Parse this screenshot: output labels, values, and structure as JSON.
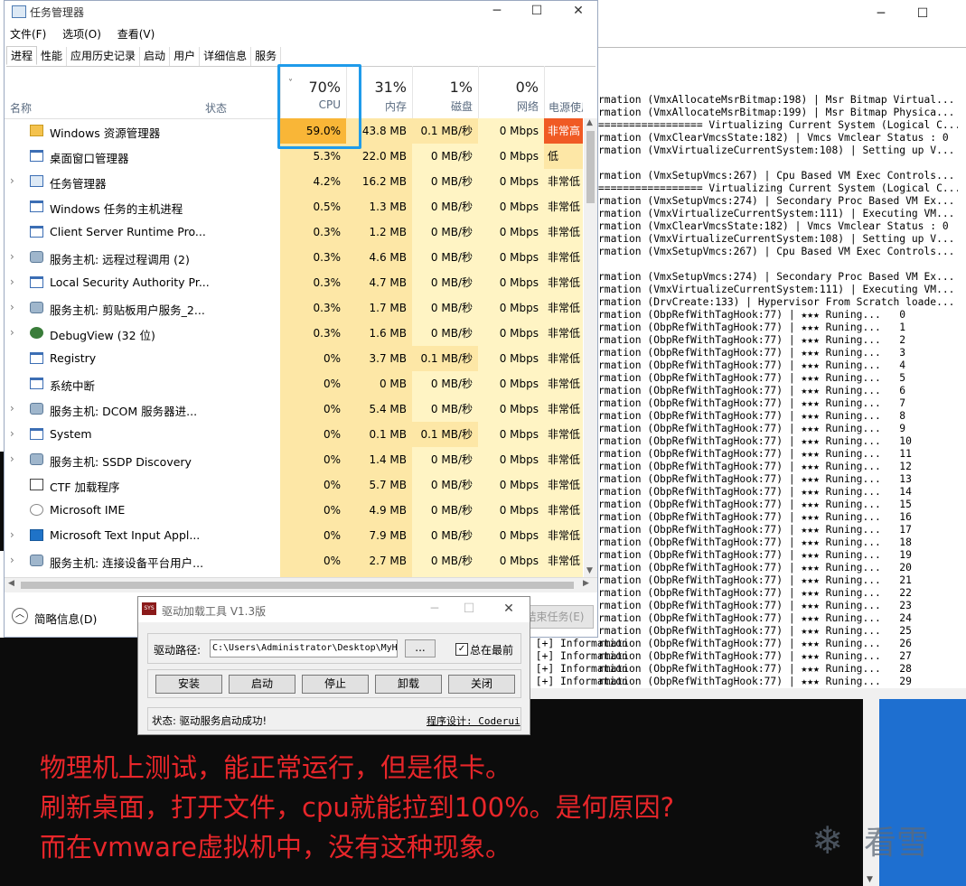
{
  "taskmgr": {
    "title": "任务管理器",
    "menu": [
      "文件(F)",
      "选项(O)",
      "查看(V)"
    ],
    "tabs": [
      "进程",
      "性能",
      "应用历史记录",
      "启动",
      "用户",
      "详细信息",
      "服务"
    ],
    "columns": {
      "name": "名称",
      "status": "状态",
      "cpu": {
        "pct": "70%",
        "label": "CPU"
      },
      "mem": {
        "pct": "31%",
        "label": "内存"
      },
      "disk": {
        "pct": "1%",
        "label": "磁盘"
      },
      "net": {
        "pct": "0%",
        "label": "网络"
      },
      "power": "电源使用"
    },
    "processes": [
      {
        "name": "Windows 资源管理器",
        "expand": false,
        "cpu": "59.0%",
        "mem": "43.8 MB",
        "disk": "0.1 MB/秒",
        "net": "0 Mbps",
        "power": "非常高",
        "icon": "explorer-icon"
      },
      {
        "name": "桌面窗口管理器",
        "expand": false,
        "cpu": "5.3%",
        "mem": "22.0 MB",
        "disk": "0 MB/秒",
        "net": "0 Mbps",
        "power": "低",
        "icon": "window-icon"
      },
      {
        "name": "任务管理器",
        "expand": true,
        "cpu": "4.2%",
        "mem": "16.2 MB",
        "disk": "0 MB/秒",
        "net": "0 Mbps",
        "power": "非常低",
        "icon": "taskmgr-icon"
      },
      {
        "name": "Windows 任务的主机进程",
        "expand": false,
        "cpu": "0.5%",
        "mem": "1.3 MB",
        "disk": "0 MB/秒",
        "net": "0 Mbps",
        "power": "非常低",
        "icon": "window-icon"
      },
      {
        "name": "Client Server Runtime Pro...",
        "expand": false,
        "cpu": "0.3%",
        "mem": "1.2 MB",
        "disk": "0 MB/秒",
        "net": "0 Mbps",
        "power": "非常低",
        "icon": "window-icon"
      },
      {
        "name": "服务主机: 远程过程调用 (2)",
        "expand": true,
        "cpu": "0.3%",
        "mem": "4.6 MB",
        "disk": "0 MB/秒",
        "net": "0 Mbps",
        "power": "非常低",
        "icon": "gear-icon"
      },
      {
        "name": "Local Security Authority Pr...",
        "expand": true,
        "cpu": "0.3%",
        "mem": "4.7 MB",
        "disk": "0 MB/秒",
        "net": "0 Mbps",
        "power": "非常低",
        "icon": "window-icon"
      },
      {
        "name": "服务主机: 剪贴板用户服务_2...",
        "expand": true,
        "cpu": "0.3%",
        "mem": "1.7 MB",
        "disk": "0 MB/秒",
        "net": "0 Mbps",
        "power": "非常低",
        "icon": "gear-icon"
      },
      {
        "name": "DebugView (32 位)",
        "expand": true,
        "cpu": "0.3%",
        "mem": "1.6 MB",
        "disk": "0 MB/秒",
        "net": "0 Mbps",
        "power": "非常低",
        "icon": "bug-icon"
      },
      {
        "name": "Registry",
        "expand": false,
        "cpu": "0%",
        "mem": "3.7 MB",
        "disk": "0.1 MB/秒",
        "net": "0 Mbps",
        "power": "非常低",
        "icon": "window-icon"
      },
      {
        "name": "系统中断",
        "expand": false,
        "cpu": "0%",
        "mem": "0 MB",
        "disk": "0 MB/秒",
        "net": "0 Mbps",
        "power": "非常低",
        "icon": "window-icon"
      },
      {
        "name": "服务主机: DCOM 服务器进...",
        "expand": true,
        "cpu": "0%",
        "mem": "5.4 MB",
        "disk": "0 MB/秒",
        "net": "0 Mbps",
        "power": "非常低",
        "icon": "gear-icon"
      },
      {
        "name": "System",
        "expand": true,
        "cpu": "0%",
        "mem": "0.1 MB",
        "disk": "0.1 MB/秒",
        "net": "0 Mbps",
        "power": "非常低",
        "icon": "window-icon"
      },
      {
        "name": "服务主机: SSDP Discovery",
        "expand": true,
        "cpu": "0%",
        "mem": "1.4 MB",
        "disk": "0 MB/秒",
        "net": "0 Mbps",
        "power": "非常低",
        "icon": "gear-icon"
      },
      {
        "name": "CTF 加载程序",
        "expand": false,
        "cpu": "0%",
        "mem": "5.7 MB",
        "disk": "0 MB/秒",
        "net": "0 Mbps",
        "power": "非常低",
        "icon": "pen-icon"
      },
      {
        "name": "Microsoft IME",
        "expand": false,
        "cpu": "0%",
        "mem": "4.9 MB",
        "disk": "0 MB/秒",
        "net": "0 Mbps",
        "power": "非常低",
        "icon": "ime-icon"
      },
      {
        "name": "Microsoft Text Input Appl...",
        "expand": true,
        "cpu": "0%",
        "mem": "7.9 MB",
        "disk": "0 MB/秒",
        "net": "0 Mbps",
        "power": "非常低",
        "icon": "keyboard-icon"
      },
      {
        "name": "服务主机: 连接设备平台用户...",
        "expand": true,
        "cpu": "0%",
        "mem": "2.7 MB",
        "disk": "0 MB/秒",
        "net": "0 Mbps",
        "power": "非常低",
        "icon": "gear-icon"
      }
    ],
    "footer": {
      "brief": "简略信息(D)",
      "end_task": "结束任务(E)"
    }
  },
  "console": {
    "lines": [
      "rmation (VmxAllocateMsrBitmap:198) | Msr Bitmap Virtual...",
      "rmation (VmxAllocateMsrBitmap:199) | Msr Bitmap Physica...",
      "================= Virtualizing Current System (Logical C...",
      "rmation (VmxClearVmcsState:182) | Vmcs Vmclear Status : 0",
      "rmation (VmxVirtualizeCurrentSystem:108) | Setting up V...",
      "",
      "rmation (VmxSetupVmcs:267) | Cpu Based VM Exec Controls...",
      "================= Virtualizing Current System (Logical C...",
      "rmation (VmxSetupVmcs:274) | Secondary Proc Based VM Ex...",
      "rmation (VmxVirtualizeCurrentSystem:111) | Executing VM...",
      "rmation (VmxClearVmcsState:182) | Vmcs Vmclear Status : 0",
      "rmation (VmxVirtualizeCurrentSystem:108) | Setting up V...",
      "rmation (VmxSetupVmcs:267) | Cpu Based VM Exec Controls...",
      "",
      "rmation (VmxSetupVmcs:274) | Secondary Proc Based VM Ex...",
      "rmation (VmxVirtualizeCurrentSystem:111) | Executing VM...",
      "rmation (DrvCreate:133) | Hypervisor From Scratch loade...",
      "rmation (ObpRefWithTagHook:77) | ★★★ Runing...   0",
      "rmation (ObpRefWithTagHook:77) | ★★★ Runing...   1",
      "rmation (ObpRefWithTagHook:77) | ★★★ Runing...   2",
      "rmation (ObpRefWithTagHook:77) | ★★★ Runing...   3",
      "rmation (ObpRefWithTagHook:77) | ★★★ Runing...   4",
      "rmation (ObpRefWithTagHook:77) | ★★★ Runing...   5",
      "rmation (ObpRefWithTagHook:77) | ★★★ Runing...   6",
      "rmation (ObpRefWithTagHook:77) | ★★★ Runing...   7",
      "rmation (ObpRefWithTagHook:77) | ★★★ Runing...   8",
      "rmation (ObpRefWithTagHook:77) | ★★★ Runing...   9",
      "rmation (ObpRefWithTagHook:77) | ★★★ Runing...   10",
      "rmation (ObpRefWithTagHook:77) | ★★★ Runing...   11",
      "rmation (ObpRefWithTagHook:77) | ★★★ Runing...   12",
      "rmation (ObpRefWithTagHook:77) | ★★★ Runing...   13",
      "rmation (ObpRefWithTagHook:77) | ★★★ Runing...   14",
      "rmation (ObpRefWithTagHook:77) | ★★★ Runing...   15",
      "rmation (ObpRefWithTagHook:77) | ★★★ Runing...   16",
      "rmation (ObpRefWithTagHook:77) | ★★★ Runing...   17",
      "rmation (ObpRefWithTagHook:77) | ★★★ Runing...   18",
      "rmation (ObpRefWithTagHook:77) | ★★★ Runing...   19",
      "rmation (ObpRefWithTagHook:77) | ★★★ Runing...   20",
      "rmation (ObpRefWithTagHook:77) | ★★★ Runing...   21",
      "rmation (ObpRefWithTagHook:77) | ★★★ Runing...   22",
      "rmation (ObpRefWithTagHook:77) | ★★★ Runing...   23",
      "rmation (ObpRefWithTagHook:77) | ★★★ Runing...   24",
      "rmation (ObpRefWithTagHook:77) | ★★★ Runing...   25",
      "rmation (ObpRefWithTagHook:77) | ★★★ Runing...   26",
      "rmation (ObpRefWithTagHook:77) | ★★★ Runing...   27",
      "rmation (ObpRefWithTagHook:77) | ★★★ Runing...   28",
      "rmation (ObpRefWithTagHook:77) | ★★★ Runing...   29"
    ],
    "left_lines": [
      " [+] Information",
      " [+] Information",
      " [+] Information",
      " [+] Information"
    ]
  },
  "dialog": {
    "title": "驱动加载工具 V1.3版",
    "icon_text": "SYS",
    "path_label": "驱动路径:",
    "path_value": "C:\\Users\\Administrator\\Desktop\\MyH",
    "browse_label": "...",
    "topmost_label": "总在最前",
    "buttons": [
      "安装",
      "启动",
      "停止",
      "卸载",
      "关闭"
    ],
    "status": "状态: 驱动服务启动成功!",
    "credit": "程序设计: Coderui"
  },
  "annotation": {
    "lines": [
      "物理机上测试，能正常运行，但是很卡。",
      "刷新桌面，打开文件，cpu就能拉到100%。是何原因?",
      "而在vmware虚拟机中，没有这种现象。"
    ],
    "color": "#e8262a"
  },
  "watermark": {
    "text": "看雪"
  },
  "colors": {
    "cpu_high": "#f9b637",
    "cpu_mid": "#fde7a6",
    "cell_light": "#fff4c4",
    "power_high": "#f05a24",
    "highlight": "#1f9bea"
  }
}
